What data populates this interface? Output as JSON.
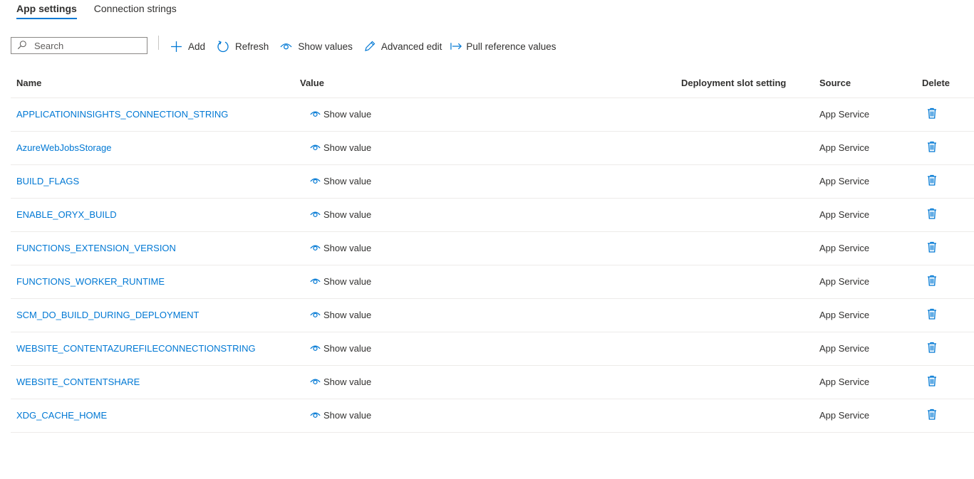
{
  "tabs": [
    {
      "label": "App settings",
      "active": true
    },
    {
      "label": "Connection strings",
      "active": false
    }
  ],
  "toolbar": {
    "search_placeholder": "Search",
    "add_label": "Add",
    "refresh_label": "Refresh",
    "show_values_label": "Show values",
    "advanced_edit_label": "Advanced edit",
    "pull_reference_label": "Pull reference values"
  },
  "table": {
    "headers": {
      "name": "Name",
      "value": "Value",
      "slot": "Deployment slot setting",
      "source": "Source",
      "delete": "Delete"
    },
    "show_value_label": "Show value",
    "rows": [
      {
        "name": "APPLICATIONINSIGHTS_CONNECTION_STRING",
        "source": "App Service"
      },
      {
        "name": "AzureWebJobsStorage",
        "source": "App Service"
      },
      {
        "name": "BUILD_FLAGS",
        "source": "App Service"
      },
      {
        "name": "ENABLE_ORYX_BUILD",
        "source": "App Service"
      },
      {
        "name": "FUNCTIONS_EXTENSION_VERSION",
        "source": "App Service"
      },
      {
        "name": "FUNCTIONS_WORKER_RUNTIME",
        "source": "App Service"
      },
      {
        "name": "SCM_DO_BUILD_DURING_DEPLOYMENT",
        "source": "App Service"
      },
      {
        "name": "WEBSITE_CONTENTAZUREFILECONNECTIONSTRING",
        "source": "App Service"
      },
      {
        "name": "WEBSITE_CONTENTSHARE",
        "source": "App Service"
      },
      {
        "name": "XDG_CACHE_HOME",
        "source": "App Service"
      }
    ]
  },
  "colors": {
    "accent": "#0078d4",
    "text": "#323130",
    "border": "#edebe9"
  }
}
